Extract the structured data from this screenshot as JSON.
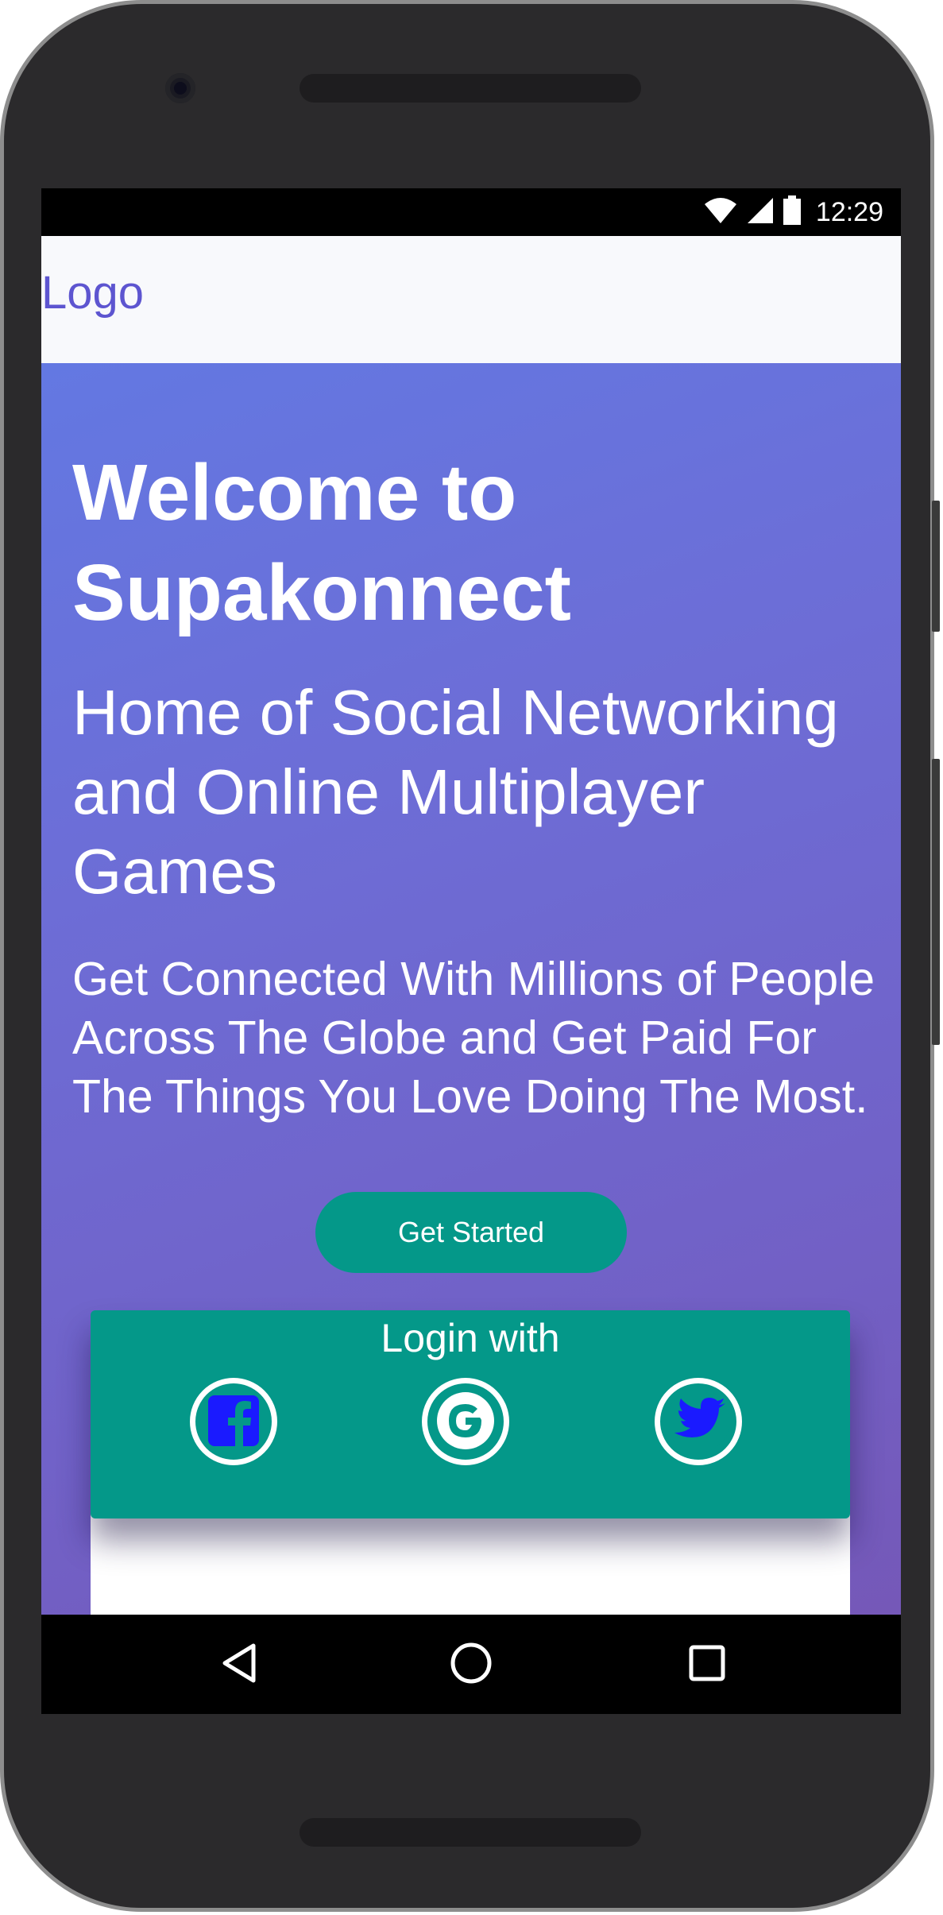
{
  "status_bar": {
    "time": "12:29",
    "icons": [
      "wifi-icon",
      "cellular-signal-icon",
      "battery-icon"
    ]
  },
  "app_bar": {
    "logo": "Logo"
  },
  "hero": {
    "title": "Welcome to Supakonnect",
    "subtitle": "Home of Social Networking and Online Multiplayer Games",
    "description": "Get Connected With Millions of People Across The Globe and Get Paid For The Things You Love Doing The Most.",
    "cta_label": "Get Started"
  },
  "login_card": {
    "title": "Login with",
    "providers": [
      "facebook-icon",
      "google-icon",
      "twitter-icon"
    ]
  },
  "nav_bar": {
    "icons": [
      "back-icon",
      "home-icon",
      "recents-icon"
    ]
  },
  "colors": {
    "accent_teal": "#049889",
    "logo_purple": "#5d55d0",
    "gradient_start": "#6378e2",
    "gradient_end": "#7558b8",
    "social_icon_blue": "#1a1aff"
  }
}
